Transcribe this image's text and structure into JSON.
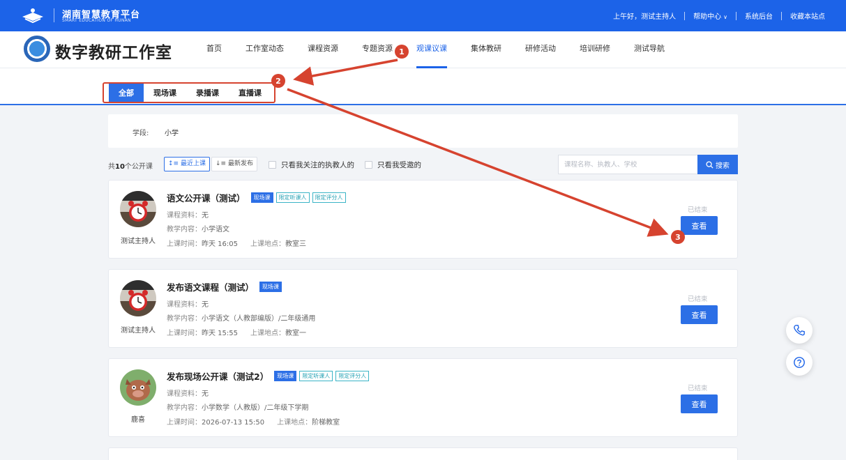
{
  "topbar": {
    "brand_cn": "湖南智慧教育平台",
    "brand_en": "SMART EDUCATION OF HUNAN",
    "greeting": "上午好，测试主持人",
    "help": "帮助中心",
    "admin": "系统后台",
    "bookmark": "收藏本站点"
  },
  "header": {
    "site_title": "数字教研工作室",
    "nav": [
      "首页",
      "工作室动态",
      "课程资源",
      "专题资源",
      "观课议课",
      "集体教研",
      "研修活动",
      "培训研修",
      "测试导航"
    ],
    "active_nav": "观课议课"
  },
  "subtabs": [
    "全部",
    "现场课",
    "录播课",
    "直播课"
  ],
  "filter": {
    "label": "学段:",
    "value": "小学"
  },
  "toolbar": {
    "total_prefix": "共",
    "total_count": "10",
    "total_suffix": "个公开课",
    "sort_recent": "最近上课",
    "sort_new": "最新发布",
    "check_follow": "只看我关注的执教人的",
    "check_invited": "只看我受邀的",
    "search_placeholder": "课程名称、执教人、学校",
    "search_button": "搜索"
  },
  "cards": [
    {
      "title": "语文公开课（测试）",
      "tags": [
        "现场课",
        "限定听课人",
        "限定评分人"
      ],
      "material_k": "课程资料：",
      "material_v": "无",
      "content_k": "教学内容：",
      "content_v": "小学语文",
      "time_k": "上课时间：",
      "time_v": "昨天 16:05",
      "place_k": "上课地点：",
      "place_v": "教室三",
      "teacher": "测试主持人",
      "status": "已结束",
      "action": "查看"
    },
    {
      "title": "发布语文课程（测试）",
      "tags": [
        "现场课"
      ],
      "material_k": "课程资料：",
      "material_v": "无",
      "content_k": "教学内容：",
      "content_v": "小学语文（人教部编版）/二年级通用",
      "time_k": "上课时间：",
      "time_v": "昨天 15:55",
      "place_k": "上课地点：",
      "place_v": "教室一",
      "teacher": "测试主持人",
      "status": "已结束",
      "action": "查看"
    },
    {
      "title": "发布现场公开课（测试2）",
      "tags": [
        "现场课",
        "限定听课人",
        "限定评分人"
      ],
      "material_k": "课程资料：",
      "material_v": "无",
      "content_k": "教学内容：",
      "content_v": "小学数学（人教版）/二年级下学期",
      "time_k": "上课时间：",
      "time_v": "2026-07-13 15:50",
      "place_k": "上课地点：",
      "place_v": "阶梯教室",
      "teacher": "鹿喜",
      "status": "已结束",
      "action": "查看"
    }
  ],
  "annotations": [
    "1",
    "2",
    "3"
  ],
  "colors": {
    "primary": "#1c63e8",
    "accent": "#2c6fe6",
    "annotation": "#d6432f"
  }
}
